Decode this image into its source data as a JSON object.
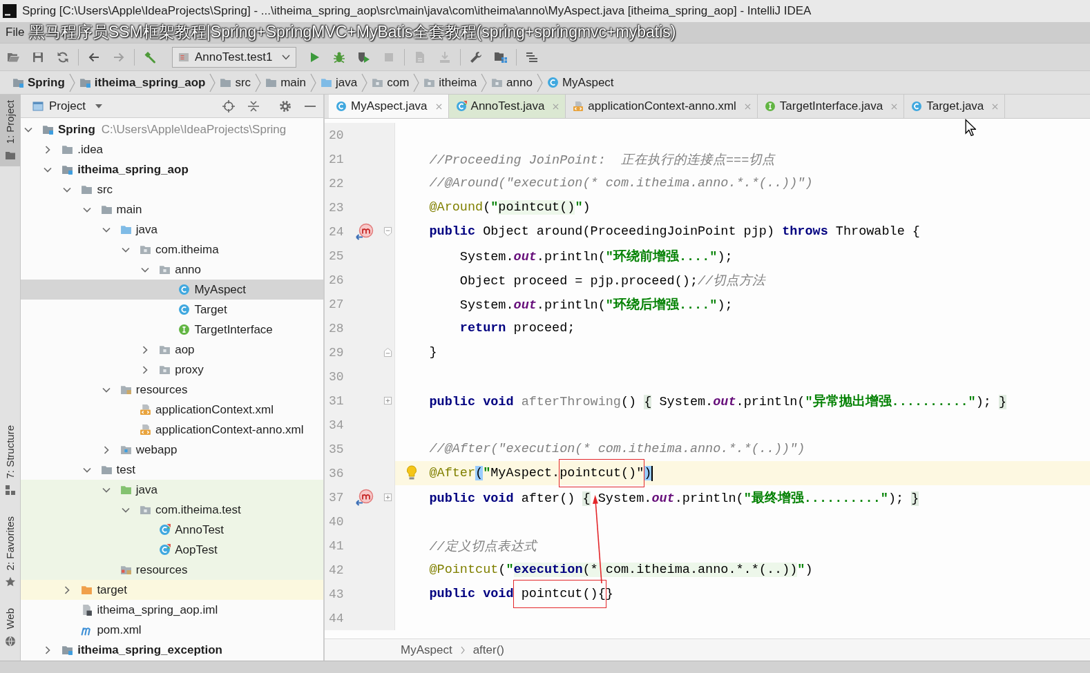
{
  "window": {
    "title": "Spring [C:\\Users\\Apple\\IdeaProjects\\Spring] - ...\\itheima_spring_aop\\src\\main\\java\\com\\itheima\\anno\\MyAspect.java [itheima_spring_aop] - IntelliJ IDEA"
  },
  "menu_bar": {
    "items": [
      "File"
    ]
  },
  "video_title_overlay": "黑马程序员SSM框架教程|Spring+SpringMVC+MyBatis全套教程(spring+springmvc+mybatis)",
  "toolbar": {
    "items": [
      {
        "kind": "open",
        "disabled": false
      },
      {
        "kind": "save",
        "disabled": false
      },
      {
        "kind": "sync",
        "disabled": false
      },
      {
        "kind": "separator"
      },
      {
        "kind": "back",
        "disabled": false
      },
      {
        "kind": "forward",
        "disabled": true
      },
      {
        "kind": "separator"
      },
      {
        "kind": "build",
        "disabled": false
      },
      {
        "kind": "run_config",
        "label": "AnnoTest.test1"
      },
      {
        "kind": "run",
        "disabled": false
      },
      {
        "kind": "debug",
        "disabled": false
      },
      {
        "kind": "coverage",
        "disabled": false
      },
      {
        "kind": "stop",
        "disabled": true
      },
      {
        "kind": "separator"
      },
      {
        "kind": "document",
        "disabled": true
      },
      {
        "kind": "download",
        "disabled": true
      },
      {
        "kind": "separator"
      },
      {
        "kind": "wrench",
        "disabled": false
      },
      {
        "kind": "structure",
        "disabled": false
      },
      {
        "kind": "separator"
      },
      {
        "kind": "hierarchy",
        "disabled": false
      }
    ]
  },
  "nav_bar": {
    "items": [
      {
        "label": "Spring",
        "kind": "project"
      },
      {
        "label": "itheima_spring_aop",
        "kind": "module"
      },
      {
        "label": "src",
        "kind": "folder"
      },
      {
        "label": "main",
        "kind": "folder"
      },
      {
        "label": "java",
        "kind": "source_root"
      },
      {
        "label": "com",
        "kind": "package"
      },
      {
        "label": "itheima",
        "kind": "package"
      },
      {
        "label": "anno",
        "kind": "package"
      },
      {
        "label": "MyAspect",
        "kind": "class"
      }
    ]
  },
  "tool_window_stripe": {
    "top": [
      {
        "label": "1: Project",
        "kind": "project",
        "selected": true
      }
    ],
    "bottom": [
      {
        "label": "7: Structure",
        "kind": "structure",
        "selected": false
      },
      {
        "label": "2: Favorites",
        "kind": "favorites",
        "selected": false
      },
      {
        "label": "Web",
        "kind": "web",
        "selected": false
      }
    ]
  },
  "project_panel": {
    "title": "Project",
    "tree": [
      {
        "label": "Spring",
        "path": "C:\\Users\\Apple\\IdeaProjects\\Spring",
        "kind": "project",
        "expanded": true,
        "selected": false,
        "children": [
          {
            "label": ".idea",
            "kind": "folder",
            "expanded": false,
            "selected": false
          },
          {
            "label": "itheima_spring_aop",
            "kind": "module",
            "expanded": true,
            "selected": false,
            "children": [
              {
                "label": "src",
                "kind": "folder",
                "expanded": true,
                "selected": false,
                "children": [
                  {
                    "label": "main",
                    "kind": "folder",
                    "expanded": true,
                    "selected": false,
                    "children": [
                      {
                        "label": "java",
                        "kind": "source_root",
                        "expanded": true,
                        "selected": false,
                        "children": [
                          {
                            "label": "com.itheima",
                            "kind": "package",
                            "expanded": true,
                            "selected": false,
                            "children": [
                              {
                                "label": "anno",
                                "kind": "package",
                                "expanded": true,
                                "selected": false,
                                "children": [
                                  {
                                    "label": "MyAspect",
                                    "kind": "class",
                                    "selected": true
                                  },
                                  {
                                    "label": "Target",
                                    "kind": "class",
                                    "selected": false
                                  },
                                  {
                                    "label": "TargetInterface",
                                    "kind": "interface",
                                    "selected": false
                                  }
                                ]
                              },
                              {
                                "label": "aop",
                                "kind": "package",
                                "expanded": false,
                                "selected": false
                              },
                              {
                                "label": "proxy",
                                "kind": "package",
                                "expanded": false,
                                "selected": false
                              }
                            ]
                          }
                        ]
                      },
                      {
                        "label": "resources",
                        "kind": "resources_root",
                        "expanded": true,
                        "selected": false,
                        "children": [
                          {
                            "label": "applicationContext.xml",
                            "kind": "xml",
                            "selected": false
                          },
                          {
                            "label": "applicationContext-anno.xml",
                            "kind": "xml",
                            "selected": false
                          }
                        ]
                      },
                      {
                        "label": "webapp",
                        "kind": "web_folder",
                        "expanded": false,
                        "selected": false
                      }
                    ]
                  },
                  {
                    "label": "test",
                    "kind": "folder",
                    "expanded": true,
                    "selected": false,
                    "children": [
                      {
                        "label": "java",
                        "kind": "test_root",
                        "expanded": true,
                        "selected": false,
                        "test_source": true,
                        "children": [
                          {
                            "label": "com.itheima.test",
                            "kind": "package",
                            "expanded": true,
                            "selected": false,
                            "test_source": true,
                            "children": [
                              {
                                "label": "AnnoTest",
                                "kind": "test_class",
                                "selected": false,
                                "test_source": true
                              },
                              {
                                "label": "AopTest",
                                "kind": "test_class",
                                "selected": false,
                                "test_source": true
                              }
                            ]
                          }
                        ]
                      },
                      {
                        "label": "resources",
                        "kind": "test_resources_root",
                        "selected": false,
                        "test_source": true
                      }
                    ]
                  }
                ]
              },
              {
                "label": "target",
                "kind": "excluded_folder",
                "expanded": false,
                "selected": false,
                "excluded": true
              },
              {
                "label": "itheima_spring_aop.iml",
                "kind": "iml",
                "selected": false
              },
              {
                "label": "pom.xml",
                "kind": "maven",
                "selected": false
              }
            ]
          },
          {
            "label": "itheima_spring_exception",
            "kind": "module",
            "expanded": false,
            "selected": false
          }
        ]
      }
    ]
  },
  "editor": {
    "tabs": [
      {
        "label": "MyAspect.java",
        "kind": "class",
        "selected": true
      },
      {
        "label": "AnnoTest.java",
        "kind": "test_class",
        "selected": false,
        "test_source": true
      },
      {
        "label": "applicationContext-anno.xml",
        "kind": "xml",
        "selected": false
      },
      {
        "label": "TargetInterface.java",
        "kind": "interface",
        "selected": false
      },
      {
        "label": "Target.java",
        "kind": "class",
        "selected": false
      }
    ],
    "lines": [
      {
        "number": "20",
        "current": false
      },
      {
        "number": "21",
        "current": false,
        "tokens": [
          {
            "text": "    //Proceeding JoinPoint:  正在执行的连接点===切点",
            "kind": "comment"
          }
        ]
      },
      {
        "number": "22",
        "current": false,
        "tokens": [
          {
            "text": "    //@Around(\"execution(* com.itheima.anno.*.*(..))\")",
            "kind": "comment"
          }
        ]
      },
      {
        "number": "23",
        "current": false,
        "tokens": [
          {
            "text": "    @Around",
            "kind": "annotation"
          },
          {
            "text": "(",
            "kind": "plain"
          },
          {
            "text": "\"",
            "kind": "string"
          },
          {
            "text": "pointcut()",
            "kind": "injected"
          },
          {
            "text": "\"",
            "kind": "string"
          },
          {
            "text": ")",
            "kind": "plain"
          }
        ]
      },
      {
        "number": "24",
        "current": false,
        "markers": [
          {
            "kind": "implements"
          },
          {
            "kind": "fold_start"
          }
        ],
        "tokens": [
          {
            "text": "    public",
            "kind": "keyword"
          },
          {
            "text": " Object around(ProceedingJoinPoint pjp) ",
            "kind": "plain"
          },
          {
            "text": "throws",
            "kind": "keyword"
          },
          {
            "text": " Throwable {",
            "kind": "plain"
          }
        ]
      },
      {
        "number": "25",
        "current": false,
        "tokens": [
          {
            "text": "        System.",
            "kind": "plain"
          },
          {
            "text": "out",
            "kind": "static_field"
          },
          {
            "text": ".println(",
            "kind": "plain"
          },
          {
            "text": "\"环绕前增强....\"",
            "kind": "string"
          },
          {
            "text": ");",
            "kind": "plain"
          }
        ]
      },
      {
        "number": "26",
        "current": false,
        "tokens": [
          {
            "text": "        Object proceed = pjp.proceed();",
            "kind": "plain"
          },
          {
            "text": "//切点方法",
            "kind": "comment"
          }
        ]
      },
      {
        "number": "27",
        "current": false,
        "tokens": [
          {
            "text": "        System.",
            "kind": "plain"
          },
          {
            "text": "out",
            "kind": "static_field"
          },
          {
            "text": ".println(",
            "kind": "plain"
          },
          {
            "text": "\"环绕后增强....\"",
            "kind": "string"
          },
          {
            "text": ");",
            "kind": "plain"
          }
        ]
      },
      {
        "number": "28",
        "current": false,
        "tokens": [
          {
            "text": "        return",
            "kind": "keyword"
          },
          {
            "text": " proceed;",
            "kind": "plain"
          }
        ]
      },
      {
        "number": "29",
        "current": false,
        "markers": [
          {
            "kind": "fold_end"
          }
        ],
        "tokens": [
          {
            "text": "    }",
            "kind": "plain"
          }
        ]
      },
      {
        "number": "30",
        "current": false
      },
      {
        "number": "31",
        "current": false,
        "markers": [
          {
            "kind": "folded"
          }
        ],
        "tokens": [
          {
            "text": "    public void",
            "kind": "keyword"
          },
          {
            "text": " afterThrowing",
            "kind": "unused"
          },
          {
            "text": "() ",
            "kind": "plain"
          },
          {
            "text": "{",
            "kind": "folded"
          },
          {
            "text": " System.",
            "kind": "plain"
          },
          {
            "text": "out",
            "kind": "static_field"
          },
          {
            "text": ".println(",
            "kind": "plain"
          },
          {
            "text": "\"异常抛出增强..........\"",
            "kind": "string"
          },
          {
            "text": "); ",
            "kind": "plain"
          },
          {
            "text": "}",
            "kind": "folded"
          }
        ]
      },
      {
        "number": "34",
        "current": false
      },
      {
        "number": "35",
        "current": false,
        "tokens": [
          {
            "text": "    //@After(\"execution(* com.itheima.anno.*.*(..))\")",
            "kind": "comment"
          }
        ]
      },
      {
        "number": "36",
        "current": true,
        "markers": [
          {
            "kind": "bulb"
          }
        ],
        "tokens": [
          {
            "text": "    @After",
            "kind": "annotation"
          },
          {
            "text": "(",
            "kind": "brace_match"
          },
          {
            "text": "\"",
            "kind": "string"
          },
          {
            "text": "MyAspect.",
            "kind": "plain"
          },
          {
            "text": "pointcut()\"",
            "kind": "plain",
            "framed": true
          },
          {
            "text": ")",
            "kind": "brace_match"
          }
        ]
      },
      {
        "number": "37",
        "current": false,
        "markers": [
          {
            "kind": "implements"
          },
          {
            "kind": "folded"
          }
        ],
        "tokens": [
          {
            "text": "    public void",
            "kind": "keyword"
          },
          {
            "text": " after() ",
            "kind": "plain"
          },
          {
            "text": "{",
            "kind": "folded"
          },
          {
            "text": " System.",
            "kind": "plain"
          },
          {
            "text": "out",
            "kind": "static_field"
          },
          {
            "text": ".println(",
            "kind": "plain"
          },
          {
            "text": "\"最终增强..........\"",
            "kind": "string"
          },
          {
            "text": "); ",
            "kind": "plain"
          },
          {
            "text": "}",
            "kind": "folded"
          }
        ]
      },
      {
        "number": "40",
        "current": false
      },
      {
        "number": "41",
        "current": false,
        "tokens": [
          {
            "text": "    //定义切点表达式",
            "kind": "comment"
          }
        ]
      },
      {
        "number": "42",
        "current": false,
        "tokens": [
          {
            "text": "    @Pointcut",
            "kind": "annotation"
          },
          {
            "text": "(",
            "kind": "plain"
          },
          {
            "text": "\"",
            "kind": "string"
          },
          {
            "text": "execution",
            "kind": "injected_keyword"
          },
          {
            "text": "(* com.itheima.anno.*.*(..))",
            "kind": "injected"
          },
          {
            "text": "\"",
            "kind": "string"
          },
          {
            "text": ")",
            "kind": "plain"
          }
        ]
      },
      {
        "number": "43",
        "current": false,
        "tokens": [
          {
            "text": "    public void",
            "kind": "keyword"
          },
          {
            "text": " pointcut(){",
            "kind": "plain",
            "framed": true
          },
          {
            "text": "}",
            "kind": "plain"
          }
        ]
      },
      {
        "number": "44",
        "current": false
      }
    ],
    "breadcrumbs": [
      "MyAspect",
      "after()"
    ]
  }
}
